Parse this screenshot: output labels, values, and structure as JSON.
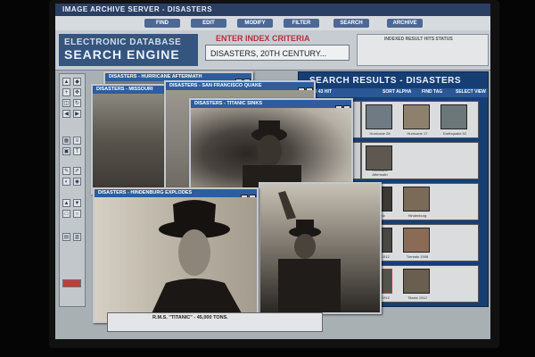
{
  "app": {
    "title": "IMAGE ARCHIVE SERVER - DISASTERS"
  },
  "menu": [
    {
      "label": "FIND"
    },
    {
      "label": "EDIT"
    },
    {
      "label": "MODIFY"
    },
    {
      "label": "FILTER"
    },
    {
      "label": "SEARCH"
    },
    {
      "label": "ARCHIVE"
    }
  ],
  "brand": {
    "line1": "ELECTRONIC DATABASE",
    "line2": "SEARCH ENGINE"
  },
  "criteria": {
    "label": "ENTER INDEX CRITERIA",
    "value": "DISASTERS, 20TH CENTURY..."
  },
  "indexed": {
    "label": "INDEXED RESULT HITS STATUS"
  },
  "results": {
    "title": "SEARCH RESULTS - DISASTERS",
    "toolbar": [
      "1,093 43 HIT",
      "SORT ALPHA",
      "FIND TAG",
      "SELECT VIEW"
    ],
    "rows": [
      {
        "thumbs": [
          "Hurricane 28",
          "Hurricane 17",
          "Earthquake 52"
        ]
      },
      {
        "thumbs": [
          "Hurricane Aftermath"
        ]
      },
      {
        "thumbs": [
          "Titanic",
          "Hindenburg"
        ]
      },
      {
        "thumbs": [
          "Titanic 1912",
          "Tornado 1908"
        ]
      },
      {
        "thumbs": [
          "Titanic 1912",
          "Titanic 1912"
        ]
      }
    ]
  },
  "windows": {
    "hurricane": "DISASTERS - HURRICANE AFTERMATH",
    "mississippi": "DISASTERS - MISSOURI",
    "quake": "DISASTERS - SAN FRANCISCO QUAKE",
    "titanic": "DISASTERS - TITANIC SINKS",
    "hindenburg": "DISASTERS - HINDENBURG EXPLODES"
  },
  "caption": {
    "text": "R.M.S. \"TITANIC\" - 45,000 TONS."
  },
  "colors": {
    "accent": "#2f5c9c",
    "results_bg": "#173e73",
    "criteria_label": "#b3323b"
  }
}
